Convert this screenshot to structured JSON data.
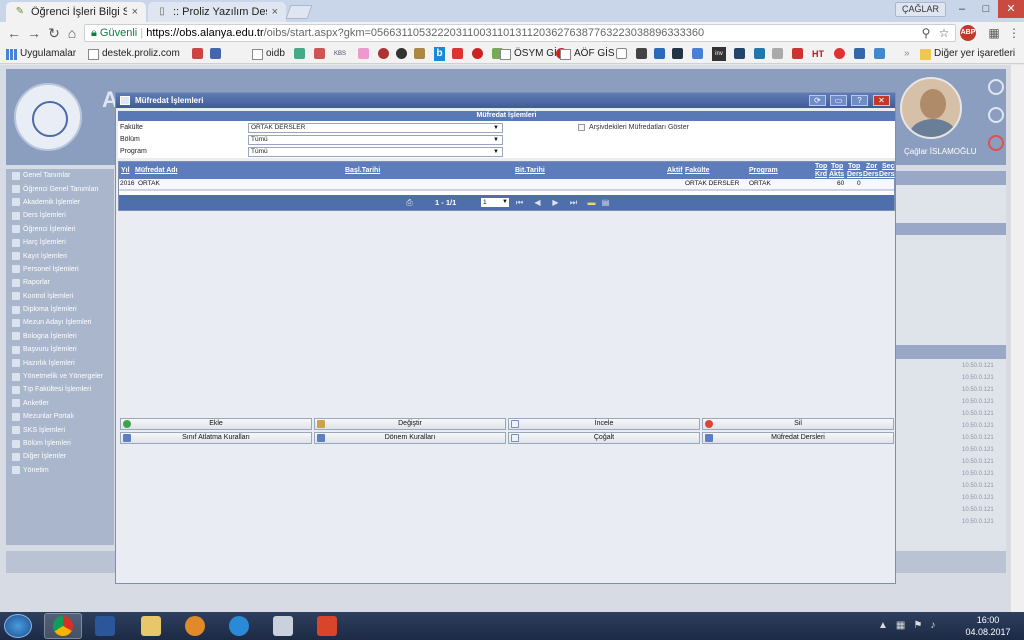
{
  "browser": {
    "tabs": [
      {
        "title": "Öğrenci İşleri Bilgi Sistem",
        "active": true
      },
      {
        "title": ":: Proliz Yazılım Destek P",
        "active": false
      }
    ],
    "profile": "ÇAĞLAR",
    "address": {
      "secure_label": "Güvenli",
      "host": "https://obs.alanya.edu.tr",
      "path": "/oibs/start.aspx?gkm=0566311053222031100311013112036276387763223038896333360"
    },
    "abp_label": "ABP",
    "bookmarks": {
      "apps": "Uygulamalar",
      "items": [
        "destek.proliz.com",
        "oidb",
        "ÖSYM GİS",
        "AÖF GİS"
      ],
      "icon_labels": [
        "KBS",
        "b",
        "HT",
        "inv"
      ],
      "other": "Diğer yer işaretleri"
    }
  },
  "app": {
    "user_name": "Çağlar İSLAMOĞLU",
    "title_partial": "A",
    "menu": [
      "Genel Tanımlar",
      "Öğrenci Genel Tanımları",
      "Akademik İşlemler",
      "Ders İşlemleri",
      "Öğrenci İşlemleri",
      "Harç İşlemleri",
      "Kayıt İşlemleri",
      "Personel İşlemleri",
      "Raporlar",
      "Kontrol İşlemleri",
      "Diploma İşlemleri",
      "Mezun Adayı İşlemleri",
      "Bologna İşlemleri",
      "Başvuru İşlemleri",
      "Hazırlık İşlemleri",
      "Yönetmelik ve Yönergeler",
      "Tıp Fakültesi İşlemleri",
      "Anketler",
      "Mezunlar Portalı",
      "SKS İşlemleri",
      "Bölüm İşlemleri",
      "Diğer İşlemler",
      "Yönetim"
    ],
    "bg_ips": [
      "10.50.0.121",
      "10.50.0.121",
      "10.50.0.121",
      "10.50.0.121",
      "10.50.0.121",
      "10.50.0.121",
      "10.50.0.121",
      "10.50.0.121",
      "10.50.0.121",
      "10.50.0.121",
      "10.50.0.121",
      "10.50.0.121",
      "10.50.0.121",
      "10.50.0.121"
    ]
  },
  "modal": {
    "title": "Müfredat İşlemleri",
    "subheader": "Müfredat İşlemleri",
    "filters": {
      "faculty_label": "Fakülte",
      "faculty_value": "ORTAK DERSLER",
      "department_label": "Bölüm",
      "department_value": "Tümü",
      "program_label": "Program",
      "program_value": "Tümü",
      "archive_checkbox_label": "Arşivdekileri Müfredatları Göster"
    },
    "grid": {
      "headers": {
        "yil": "Yıl",
        "mufredat_adi": "Müfredat Adı",
        "bas_tarihi": "Başl.Tarihi",
        "bit_tarihi": "Bit.Tarihi",
        "aktif": "Aktif",
        "fakulte": "Fakülte",
        "program": "Program",
        "top_krd_1": "Top",
        "top_krd_2": "Krd",
        "top_akts_1": "Top",
        "top_akts_2": "Akts",
        "top_ders_1": "Top",
        "top_ders_2": "Ders",
        "zor_ders_1": "Zor",
        "zor_ders_2": "Ders",
        "sec_ders_1": "Seç",
        "sec_ders_2": "Ders"
      },
      "rows": [
        {
          "yil": "2016",
          "mufredat_adi": "ORTAK",
          "fakulte": "ORTAK DERSLER",
          "program": "ORTAK",
          "top_akts": "60",
          "top_ders": "0"
        }
      ],
      "pager_text": "1 - 1/1",
      "page_select": "1"
    },
    "actions": [
      "Ekle",
      "Değiştir",
      "İncele",
      "Sil",
      "Sınıf Atlatma Kuralları",
      "Dönem Kuralları",
      "Çoğalt",
      "Müfredat Dersleri"
    ]
  },
  "taskbar": {
    "time": "16:00",
    "date": "04.08.2017"
  }
}
